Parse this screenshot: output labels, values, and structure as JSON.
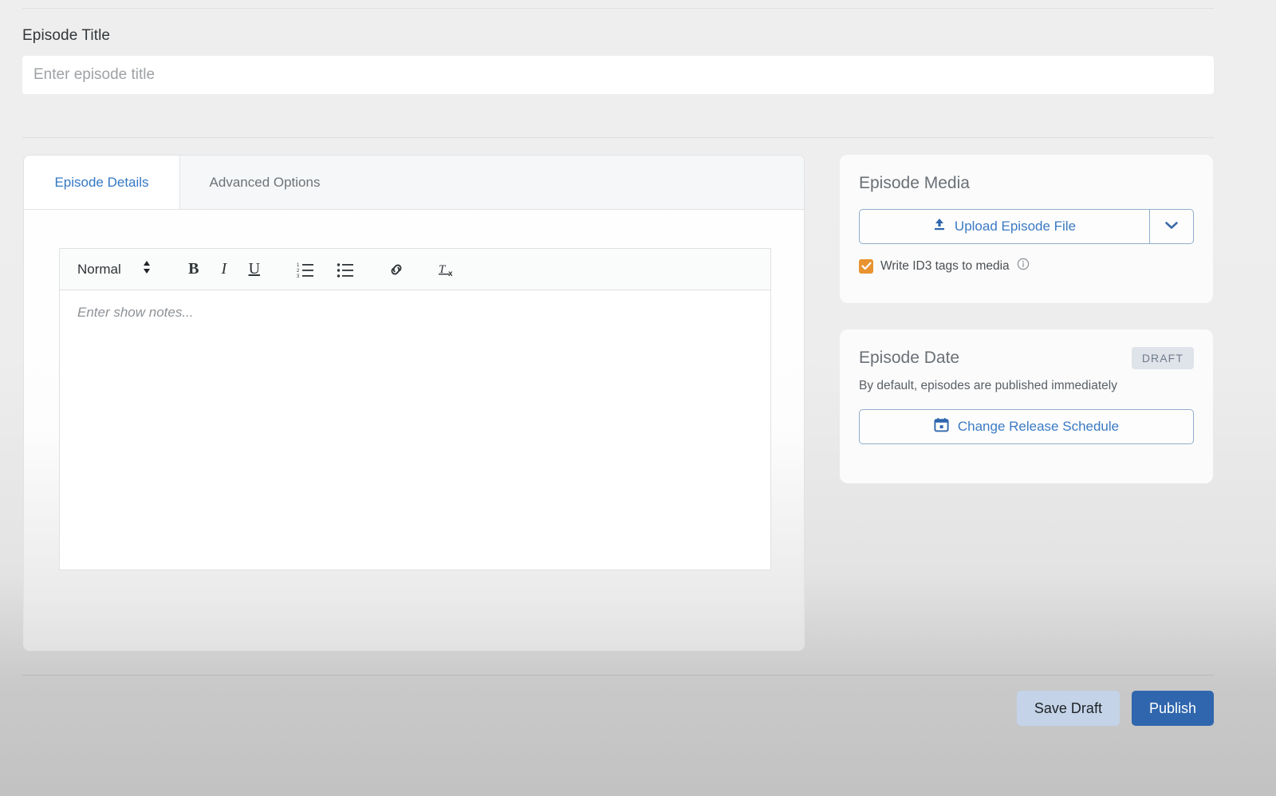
{
  "episode_title": {
    "label": "Episode Title",
    "placeholder": "Enter episode title",
    "value": ""
  },
  "tabs": [
    {
      "label": "Episode Details",
      "active": true
    },
    {
      "label": "Advanced Options",
      "active": false
    }
  ],
  "editor": {
    "format_select": "Normal",
    "placeholder": "Enter show notes...",
    "toolbar": [
      {
        "name": "format-select",
        "label": "Normal"
      },
      {
        "name": "bold-icon",
        "glyph": "B"
      },
      {
        "name": "italic-icon",
        "glyph": "I"
      },
      {
        "name": "underline-icon",
        "glyph": "U"
      },
      {
        "name": "ordered-list-icon",
        "glyph": ""
      },
      {
        "name": "bullet-list-icon",
        "glyph": ""
      },
      {
        "name": "link-icon",
        "glyph": ""
      },
      {
        "name": "clear-format-icon",
        "glyph": "Tx"
      }
    ]
  },
  "episode_media": {
    "title": "Episode Media",
    "upload_label": "Upload Episode File",
    "dropdown_icon": "chevron-down-icon",
    "upload_icon": "upload-icon",
    "id3_label": "Write ID3 tags to media",
    "id3_checked": true,
    "info_icon": "info-icon"
  },
  "episode_date": {
    "title": "Episode Date",
    "badge": "DRAFT",
    "description": "By default, episodes are published immediately",
    "schedule_label": "Change Release Schedule",
    "calendar_icon": "calendar-icon"
  },
  "footer": {
    "save_label": "Save Draft",
    "publish_label": "Publish"
  },
  "colors": {
    "accent_blue": "#3b7ac4",
    "primary_button": "#2f66ad",
    "secondary_button": "#c4d3e8",
    "checkbox_orange": "#e8932f",
    "badge_bg": "#dfe3ea",
    "badge_text": "#6f7d8c"
  }
}
